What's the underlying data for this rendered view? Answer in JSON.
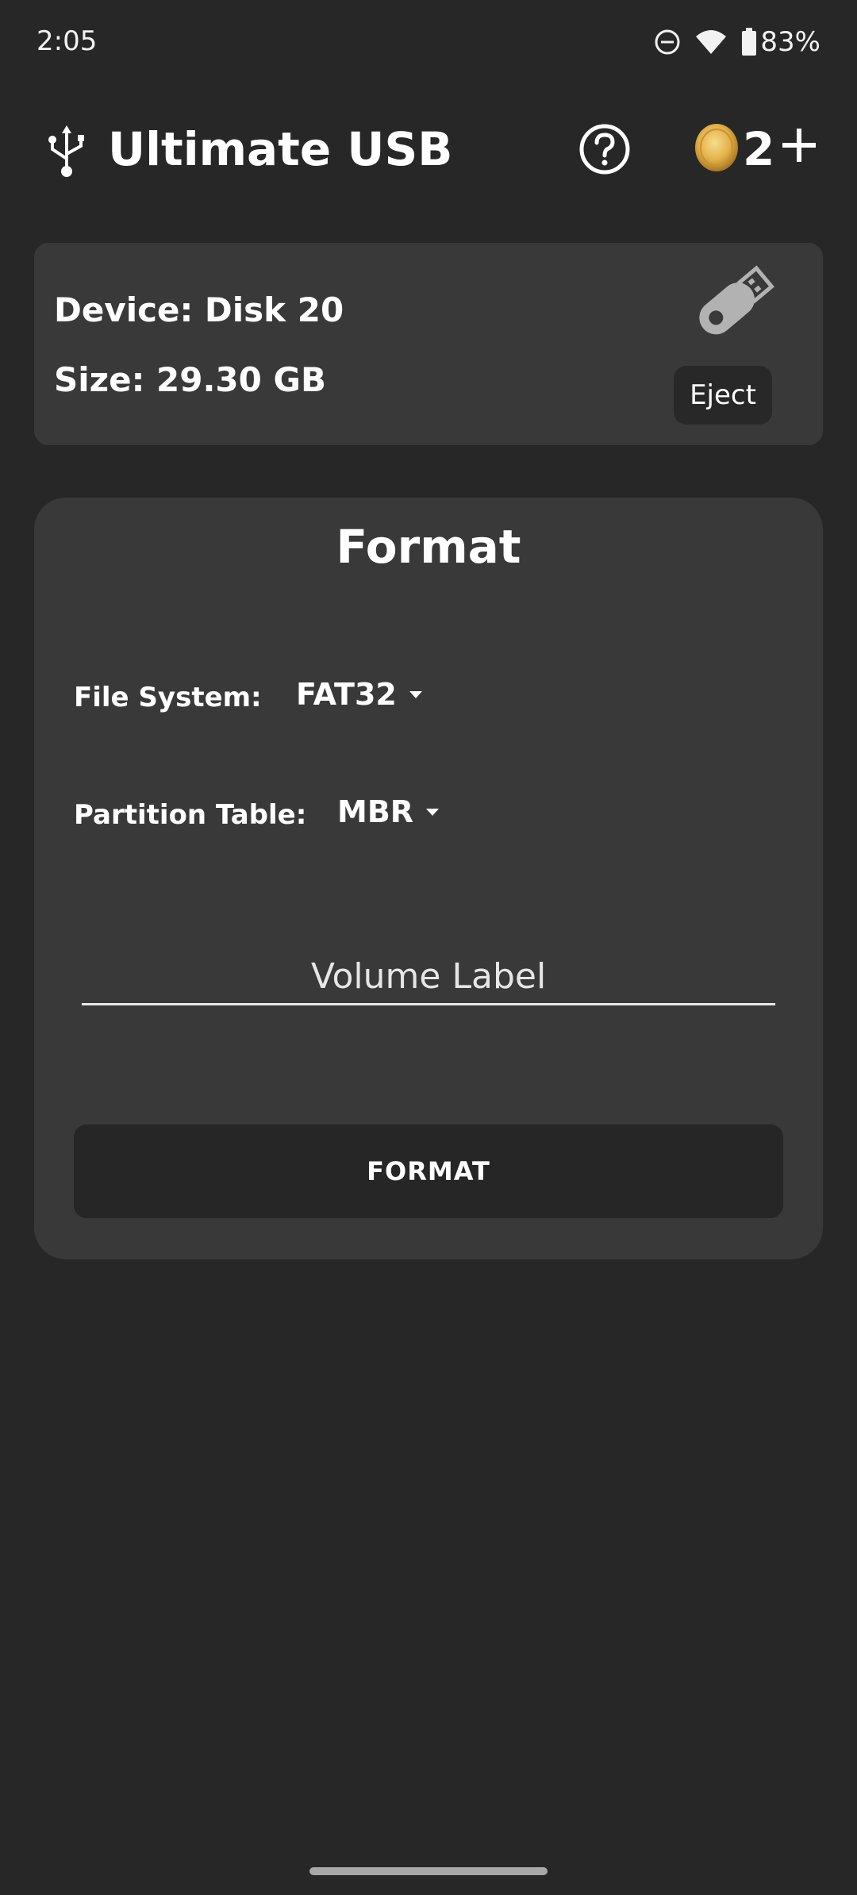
{
  "status_bar": {
    "time": "2:05",
    "battery_percent": "83%",
    "icons": [
      "do-not-disturb-icon",
      "wifi-icon",
      "battery-icon"
    ]
  },
  "app_bar": {
    "title": "Ultimate USB",
    "coin_count": "2",
    "icons": [
      "usb-icon",
      "help-icon",
      "coin-icon",
      "plus-icon"
    ]
  },
  "device": {
    "name_text": "Device: Disk 20",
    "size_text": "Size: 29.30 GB",
    "eject_label": "Eject",
    "icon": "usb-flash-drive-icon"
  },
  "format": {
    "title": "Format",
    "file_system_label": "File System:",
    "file_system_value": "FAT32",
    "partition_table_label": "Partition Table:",
    "partition_table_value": "MBR",
    "volume_label_placeholder": "Volume Label",
    "volume_label_value": "",
    "format_button_label": "FORMAT"
  },
  "colors": {
    "background": "#272727",
    "card": "#393939",
    "button": "#262626",
    "coin_gold": "#e3b14a",
    "text": "#ffffff"
  }
}
